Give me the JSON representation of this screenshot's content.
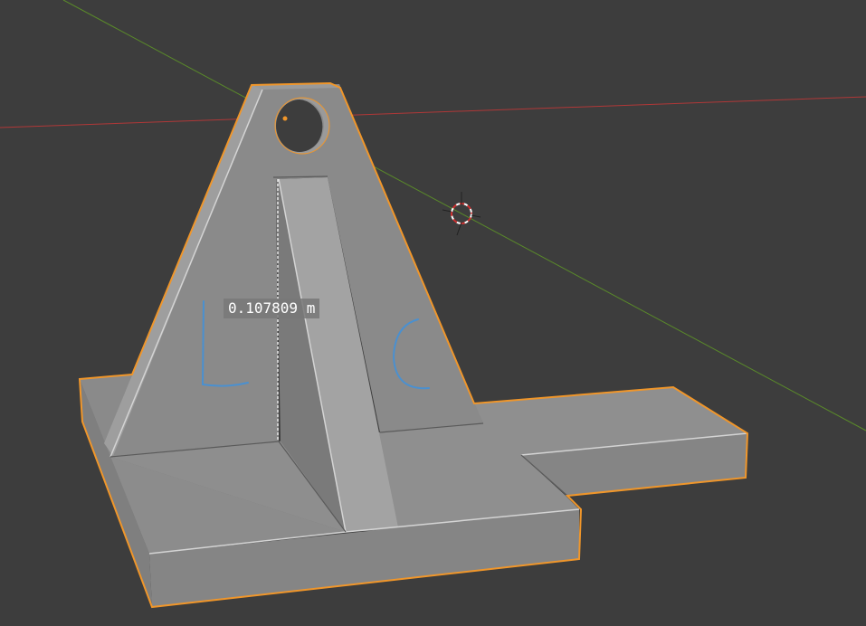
{
  "viewport": {
    "background": "#3d3d3d",
    "measurement": {
      "value_text": "0.107809 m"
    },
    "colors": {
      "x_axis": "#b03838",
      "y_axis": "#5a8a2a",
      "selection_outline": "#f0962a",
      "face_light": "#a6a6a6",
      "face_mid": "#8c8c8c",
      "face_dark": "#7b7b7b",
      "annotation": "#4a90d0"
    },
    "annotations": [
      "L",
      "C"
    ]
  }
}
